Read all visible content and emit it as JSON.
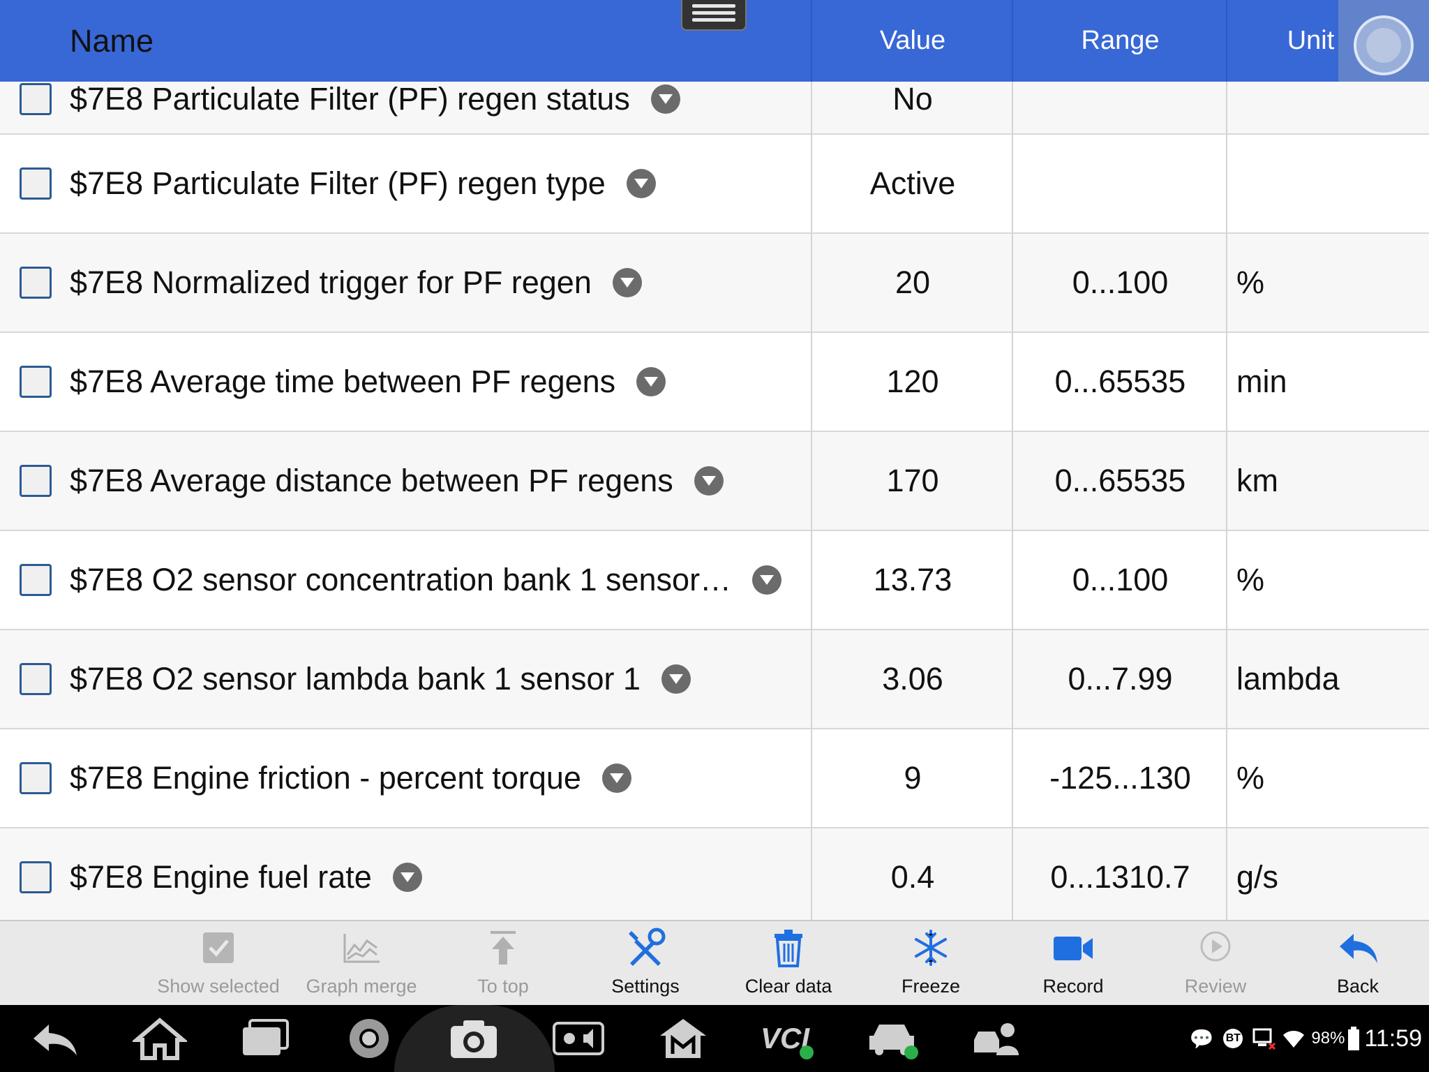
{
  "header": {
    "name": "Name",
    "value": "Value",
    "range": "Range",
    "unit": "Unit"
  },
  "rows": [
    {
      "name": "$7E8 Particulate Filter (PF) regen status",
      "value": "No",
      "range": "",
      "unit": ""
    },
    {
      "name": "$7E8 Particulate Filter (PF) regen type",
      "value": "Active",
      "range": "",
      "unit": ""
    },
    {
      "name": "$7E8 Normalized trigger for PF regen",
      "value": "20",
      "range": "0...100",
      "unit": "%"
    },
    {
      "name": "$7E8 Average time between PF regens",
      "value": "120",
      "range": "0...65535",
      "unit": "min"
    },
    {
      "name": "$7E8 Average distance between PF regens",
      "value": "170",
      "range": "0...65535",
      "unit": "km"
    },
    {
      "name": "$7E8 O2 sensor concentration bank 1 sensor…",
      "value": "13.73",
      "range": "0...100",
      "unit": "%"
    },
    {
      "name": "$7E8 O2 sensor lambda bank 1 sensor 1",
      "value": "3.06",
      "range": "0...7.99",
      "unit": "lambda"
    },
    {
      "name": "$7E8 Engine friction - percent torque",
      "value": "9",
      "range": "-125...130",
      "unit": "%"
    },
    {
      "name": "$7E8 Engine fuel rate",
      "value": "0.4",
      "range": "0...1310.7",
      "unit": "g/s"
    }
  ],
  "toolbar": {
    "show_selected": "Show selected",
    "graph_merge": "Graph merge",
    "to_top": "To top",
    "settings": "Settings",
    "clear_data": "Clear data",
    "freeze": "Freeze",
    "record": "Record",
    "review": "Review",
    "back": "Back"
  },
  "status": {
    "bt": "BT",
    "battery": "98%",
    "time": "11:59"
  },
  "colors": {
    "header_bg": "#3867d6",
    "accent_blue": "#1f6fe0",
    "nav_bg": "#000000"
  }
}
